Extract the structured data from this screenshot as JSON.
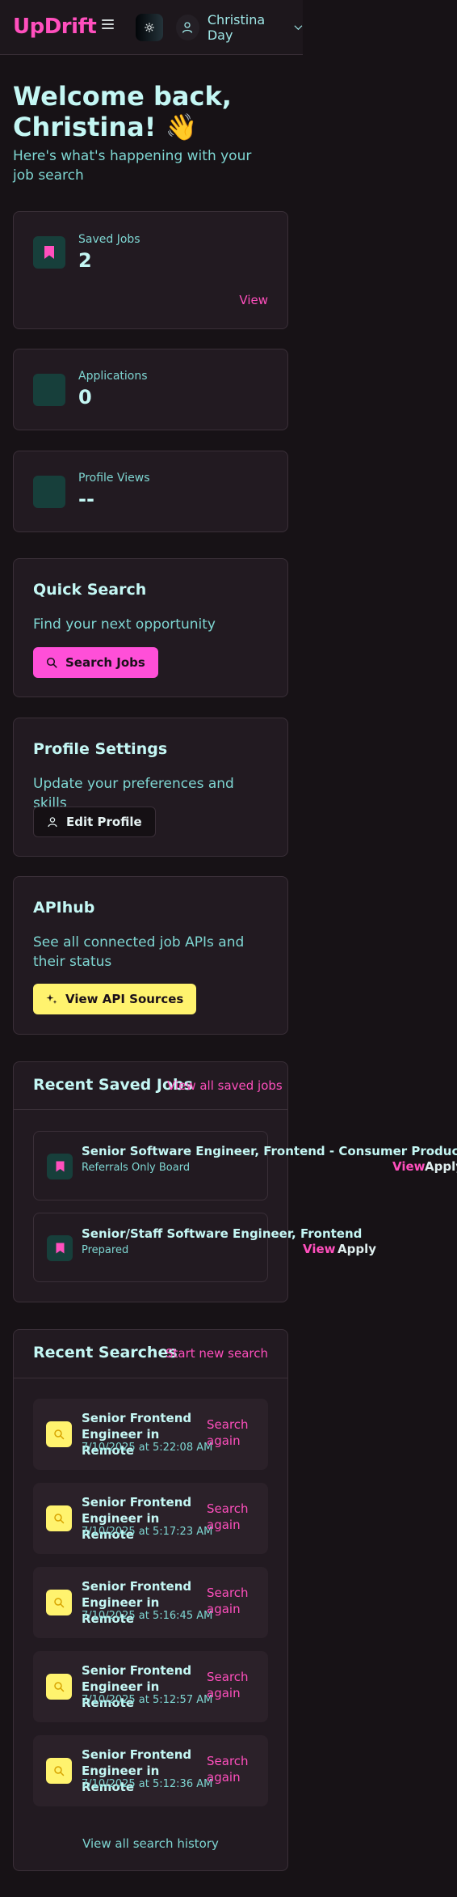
{
  "header": {
    "logo": "UpDrift",
    "user_name": "Christina Day"
  },
  "welcome": {
    "title": "Welcome back, Christina! 👋",
    "subtitle": "Here's what's happening with your job search"
  },
  "stats": [
    {
      "label": "Saved Jobs",
      "value": "2",
      "link": "View"
    },
    {
      "label": "Applications",
      "value": "0"
    },
    {
      "label": "Profile Views",
      "value": "--"
    }
  ],
  "quick_search": {
    "title": "Quick Search",
    "description": "Find your next opportunity",
    "button": "Search Jobs"
  },
  "profile_settings": {
    "title": "Profile Settings",
    "description": "Update your preferences and skills",
    "button": "Edit Profile"
  },
  "apihub": {
    "title": "APIhub",
    "description": "See all connected job APIs and their status",
    "button": "View API Sources"
  },
  "recent_saved_jobs": {
    "title": "Recent Saved Jobs",
    "view_all": "View all saved jobs",
    "jobs": [
      {
        "title": "Senior Software Engineer, Frontend - Consumer Products",
        "company": "Referrals Only Board",
        "view": "View",
        "apply": "Apply"
      },
      {
        "title": "Senior/Staff Software Engineer, Frontend",
        "company": "Prepared",
        "view": "View",
        "apply": "Apply"
      }
    ]
  },
  "recent_searches": {
    "title": "Recent Searches",
    "new_search": "Start new search",
    "items": [
      {
        "query": "Senior Frontend Engineer in Remote",
        "time": "7/10/2025 at 5:22:08 AM",
        "action": "Search again"
      },
      {
        "query": "Senior Frontend Engineer in Remote",
        "time": "7/10/2025 at 5:17:23 AM",
        "action": "Search again"
      },
      {
        "query": "Senior Frontend Engineer in Remote",
        "time": "7/10/2025 at 5:16:45 AM",
        "action": "Search again"
      },
      {
        "query": "Senior Frontend Engineer in Remote",
        "time": "7/10/2025 at 5:12:57 AM",
        "action": "Search again"
      },
      {
        "query": "Senior Frontend Engineer in Remote",
        "time": "7/10/2025 at 5:12:36 AM",
        "action": "Search again"
      }
    ],
    "view_history": "View all search history"
  },
  "colors": {
    "background": "#171216",
    "card": "#221a21",
    "accent_pink": "#ff4fbd",
    "accent_yellow": "#fff36e",
    "text_teal": "#7ed6d2",
    "icon_teal_bg": "#173f3b"
  },
  "icons": {
    "menu": "hamburger-icon",
    "theme": "sun-icon",
    "user": "user-icon",
    "saved": "bookmark-icon",
    "search": "magnifier-icon",
    "sparkles": "sparkles-icon"
  }
}
